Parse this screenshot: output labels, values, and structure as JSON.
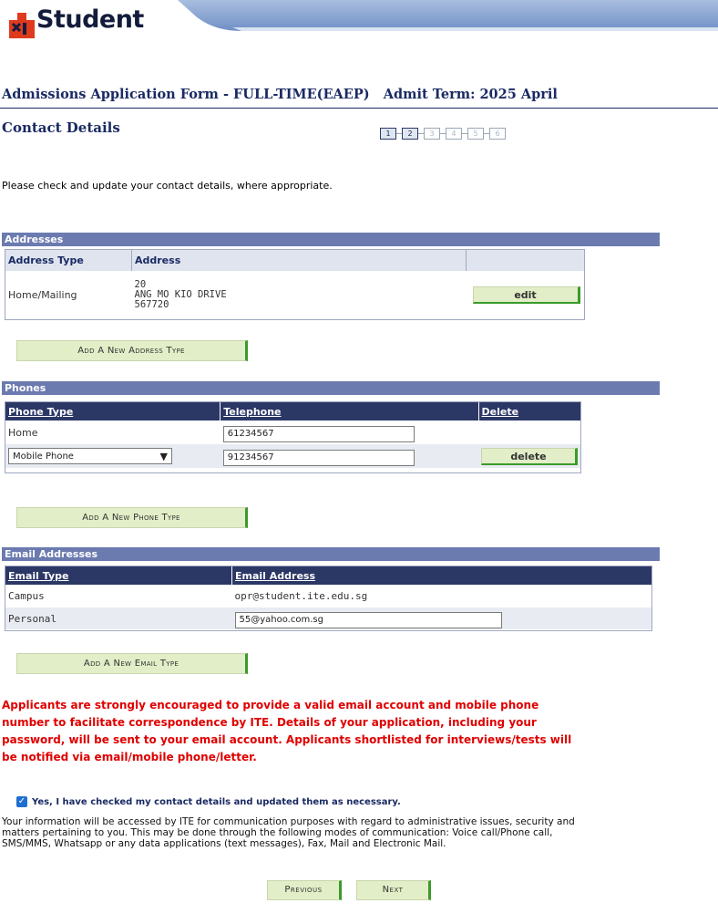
{
  "header": {
    "logo_text": "Student",
    "form_title": "Admissions Application Form - FULL-TIME(EAEP)   Admit Term: 2025 April",
    "section_title": "Contact Details"
  },
  "steps": [
    "1",
    "2",
    "3",
    "4",
    "5",
    "6"
  ],
  "intro": "Please check and update your contact details, where appropriate.",
  "addresses": {
    "heading": "Addresses",
    "col_type": "Address Type",
    "col_address": "Address",
    "row": {
      "type": "Home/Mailing",
      "line1": "20",
      "line2": "ANG MO KIO DRIVE",
      "line3": "567720",
      "edit_label": "edit"
    },
    "add_label": "Add A New Address Type"
  },
  "phones": {
    "heading": "Phones",
    "col_type": "Phone Type",
    "col_tel": "Telephone",
    "col_delete": "Delete",
    "rows": [
      {
        "type": "Home",
        "number": "61234567"
      },
      {
        "type": "Mobile Phone",
        "number": "91234567",
        "delete_label": "delete"
      }
    ],
    "add_label": "Add A New Phone Type"
  },
  "emails": {
    "heading": "Email Addresses",
    "col_type": "Email Type",
    "col_address": "Email Address",
    "rows": [
      {
        "type": "Campus",
        "address": "opr@student.ite.edu.sg"
      },
      {
        "type": "Personal",
        "address": "55@yahoo.com.sg"
      }
    ],
    "add_label": "Add A New Email Type"
  },
  "warning": "Applicants are strongly encouraged to provide a valid email account and mobile phone number to facilitate correspondence by ITE. Details of your application, including your password, will be sent to your email account. Applicants shortlisted for interviews/tests will be notified via email/mobile phone/letter.",
  "confirm": {
    "label": "Yes, I have checked my contact details and updated them as necessary.",
    "checked": true
  },
  "notice": "Your information will be accessed by ITE for communication purposes with regard to administrative issues, security and matters pertaining to you. This may be done through the following modes of communication: Voice call/Phone call, SMS/MMS, Whatsapp or any data applications (text messages), Fax, Mail and Electronic Mail.",
  "nav": {
    "previous": "Previous",
    "next": "Next"
  },
  "colors": {
    "title_navy": "#1a2a63",
    "grid_header": "#6b7bb0",
    "button_green": "#e2eec7",
    "warning_red": "#e00000"
  }
}
